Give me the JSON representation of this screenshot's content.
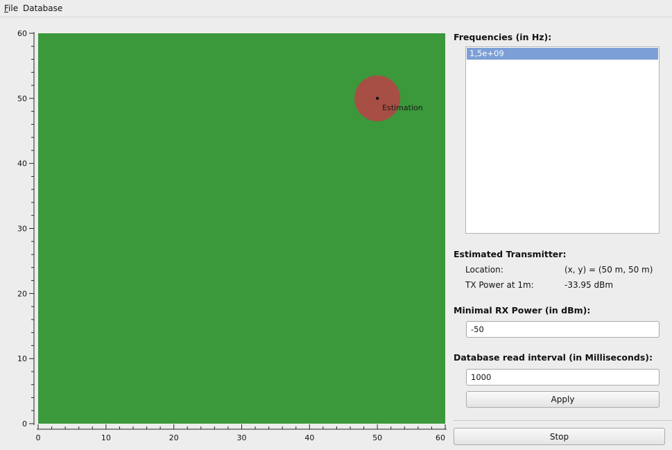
{
  "menu": {
    "file_mnemonic": "F",
    "file_rest": "ile",
    "database": "Database"
  },
  "colors": {
    "plot_bg": "#3b983b",
    "estimation_circle": "#b44747",
    "selection": "#7b9fd6"
  },
  "chart_data": {
    "type": "scatter",
    "xlim": [
      0,
      60
    ],
    "ylim": [
      0,
      60
    ],
    "xticks": [
      "0",
      "10",
      "20",
      "30",
      "40",
      "50",
      "60"
    ],
    "yticks": [
      "0",
      "10",
      "20",
      "30",
      "40",
      "50",
      "60"
    ],
    "points": [
      {
        "x": 50,
        "y": 50,
        "label": "Estimation"
      }
    ]
  },
  "panel": {
    "freq_title": "Frequencies (in Hz):",
    "frequencies": [
      "1,5e+09"
    ],
    "est_title": "Estimated Transmitter:",
    "location_label": "Location:",
    "location_value": "(x, y) = (50 m, 50 m)",
    "txpower_label": "TX Power at 1m:",
    "txpower_value": "-33.95 dBm",
    "minrx_title": "Minimal RX Power (in dBm):",
    "minrx_value": "-50",
    "interval_title": "Database read interval (in Milliseconds):",
    "interval_value": "1000",
    "apply_label": "Apply",
    "stop_label": "Stop"
  }
}
